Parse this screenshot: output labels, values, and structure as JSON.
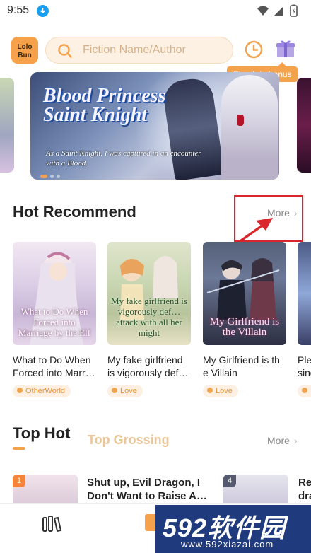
{
  "status_bar": {
    "time": "9:55"
  },
  "header": {
    "logo_text": "Lolo Bun",
    "search_placeholder": "Fiction Name/Author",
    "checkin_label": "Check-in bonus"
  },
  "banner": {
    "title": "Blood Princess Saint Knight",
    "tagline": "As a Saint Knight, I was captured in an encounter with a Blood.",
    "slides": 3,
    "active_slide": 1
  },
  "hot_recommend": {
    "title": "Hot Recommend",
    "more_label": "More",
    "books": [
      {
        "cover_text": "What to Do When Forced into Marriage by the Elf",
        "name": "What to Do When Forced into Marr…",
        "tag": "OtherWorld"
      },
      {
        "cover_text": "My fake girlfriend is vigorously def… attack with all her might",
        "name": "My fake girlfriend is vigorously def…",
        "tag": "Love"
      },
      {
        "cover_text": "My Girlfriend is the Villain",
        "name": "My Girlfriend is th e Villain",
        "tag": "Love"
      },
      {
        "cover_text": "",
        "name": "Ple… sing M…",
        "tag": ""
      }
    ]
  },
  "top_hot": {
    "tab_active": "Top Hot",
    "tab_inactive": "Top Grossing",
    "more_label": "More",
    "items": [
      {
        "rank": "1",
        "title": "Shut up, Evil Dragon, I Don't Want to Raise A…"
      },
      {
        "rank": "4",
        "title": "Re… dra…"
      }
    ]
  },
  "watermark": {
    "brand": "592软件园",
    "url": "www.592xiazai.com"
  },
  "colors": {
    "accent": "#f5a24c",
    "annotation_red": "#d9262c",
    "text": "#222222"
  }
}
